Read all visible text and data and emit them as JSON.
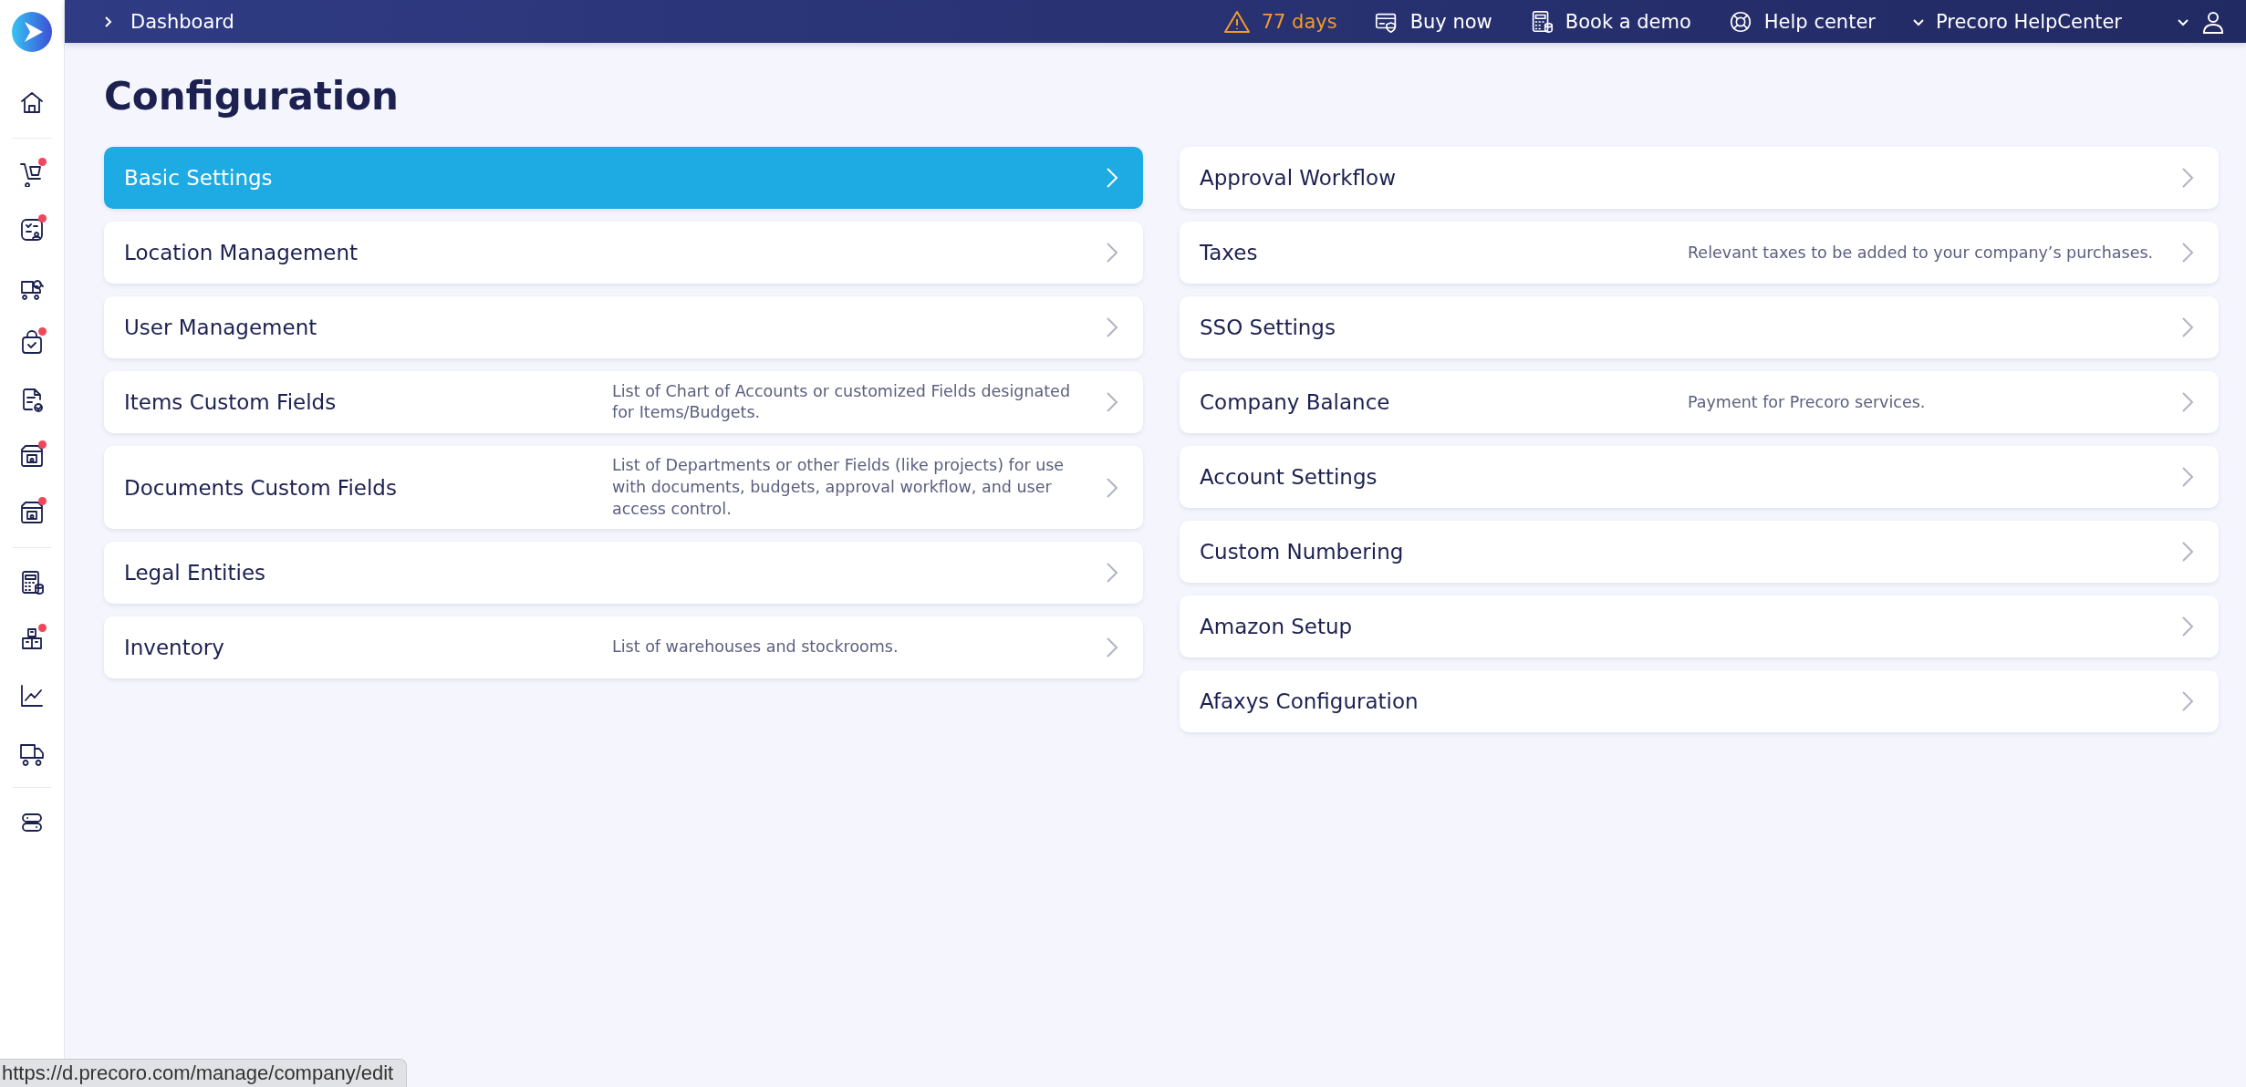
{
  "sidebar": {
    "groups": [
      {
        "items": [
          {
            "kind": "home",
            "badge": false
          }
        ]
      },
      {
        "items": [
          {
            "kind": "cart",
            "badge": true
          },
          {
            "kind": "checklist",
            "badge": true
          },
          {
            "kind": "truck-search",
            "badge": false
          },
          {
            "kind": "bag-check",
            "badge": true
          },
          {
            "kind": "doc-check",
            "badge": false
          },
          {
            "kind": "box-camera",
            "badge": true
          },
          {
            "kind": "box-camera",
            "badge": true
          }
        ]
      },
      {
        "items": [
          {
            "kind": "calculator",
            "badge": false
          },
          {
            "kind": "boxes",
            "badge": true
          },
          {
            "kind": "chart",
            "badge": false
          },
          {
            "kind": "truck",
            "badge": false
          }
        ]
      },
      {
        "items": [
          {
            "kind": "toggle",
            "badge": false
          }
        ]
      }
    ]
  },
  "topbar": {
    "breadcrumb": "Dashboard",
    "trial": "77 days",
    "actions": [
      {
        "kind": "card",
        "label": "Buy now"
      },
      {
        "kind": "calculator",
        "label": "Book a demo"
      },
      {
        "kind": "lifebuoy",
        "label": "Help center"
      }
    ],
    "company": "Precoro HelpCenter"
  },
  "page": {
    "title": "Configuration",
    "columns": [
      [
        {
          "name": "Basic Settings",
          "selected": true
        },
        {
          "name": "Location Management",
          "selected": false
        },
        {
          "name": "User Management",
          "selected": false
        },
        {
          "name": "Items Custom Fields",
          "description": "List of Chart of Accounts or customized Fields designated for Items/Budgets.",
          "selected": false
        },
        {
          "name": "Documents Custom Fields",
          "description": "List of Departments or other Fields (like projects) for use with documents, budgets, approval workflow, and user access control.",
          "selected": false
        },
        {
          "name": "Legal Entities",
          "selected": false
        },
        {
          "name": "Inventory",
          "description": "List of warehouses and stockrooms.",
          "selected": false
        }
      ],
      [
        {
          "name": "Approval Workflow",
          "selected": false
        },
        {
          "name": "Taxes",
          "description": "Relevant taxes to be added to your company’s purchases.",
          "selected": false
        },
        {
          "name": "SSO Settings",
          "selected": false
        },
        {
          "name": "Company Balance",
          "description": "Payment for Precoro services.",
          "selected": false
        },
        {
          "name": "Account Settings",
          "selected": false
        },
        {
          "name": "Custom Numbering",
          "selected": false
        },
        {
          "name": "Amazon Setup",
          "selected": false
        },
        {
          "name": "Afaxys Configuration",
          "selected": false
        }
      ]
    ]
  },
  "status_url": "https://d.precoro.com/manage/company/edit"
}
